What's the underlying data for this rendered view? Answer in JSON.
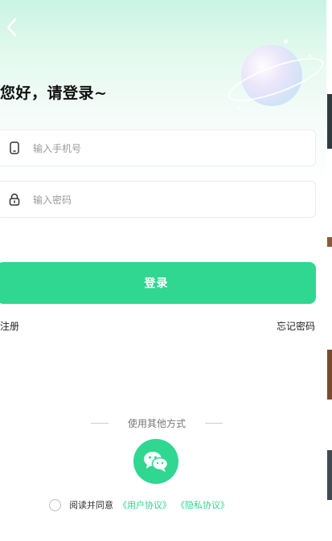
{
  "header": {
    "title": "您好，请登录~"
  },
  "form": {
    "phone_placeholder": "输入手机号",
    "password_placeholder": "输入密码",
    "login_label": "登录"
  },
  "links": {
    "register": "注册",
    "forgot_password": "忘记密码"
  },
  "other_login": {
    "label": "使用其他方式",
    "wechat_icon": "wechat-icon"
  },
  "agreement": {
    "prefix": "阅读并同意",
    "user_agreement": "《用户协议》",
    "privacy_agreement": "《隐私协议》"
  },
  "colors": {
    "accent": "#2fd791",
    "background_top": "#c9f4e3"
  }
}
